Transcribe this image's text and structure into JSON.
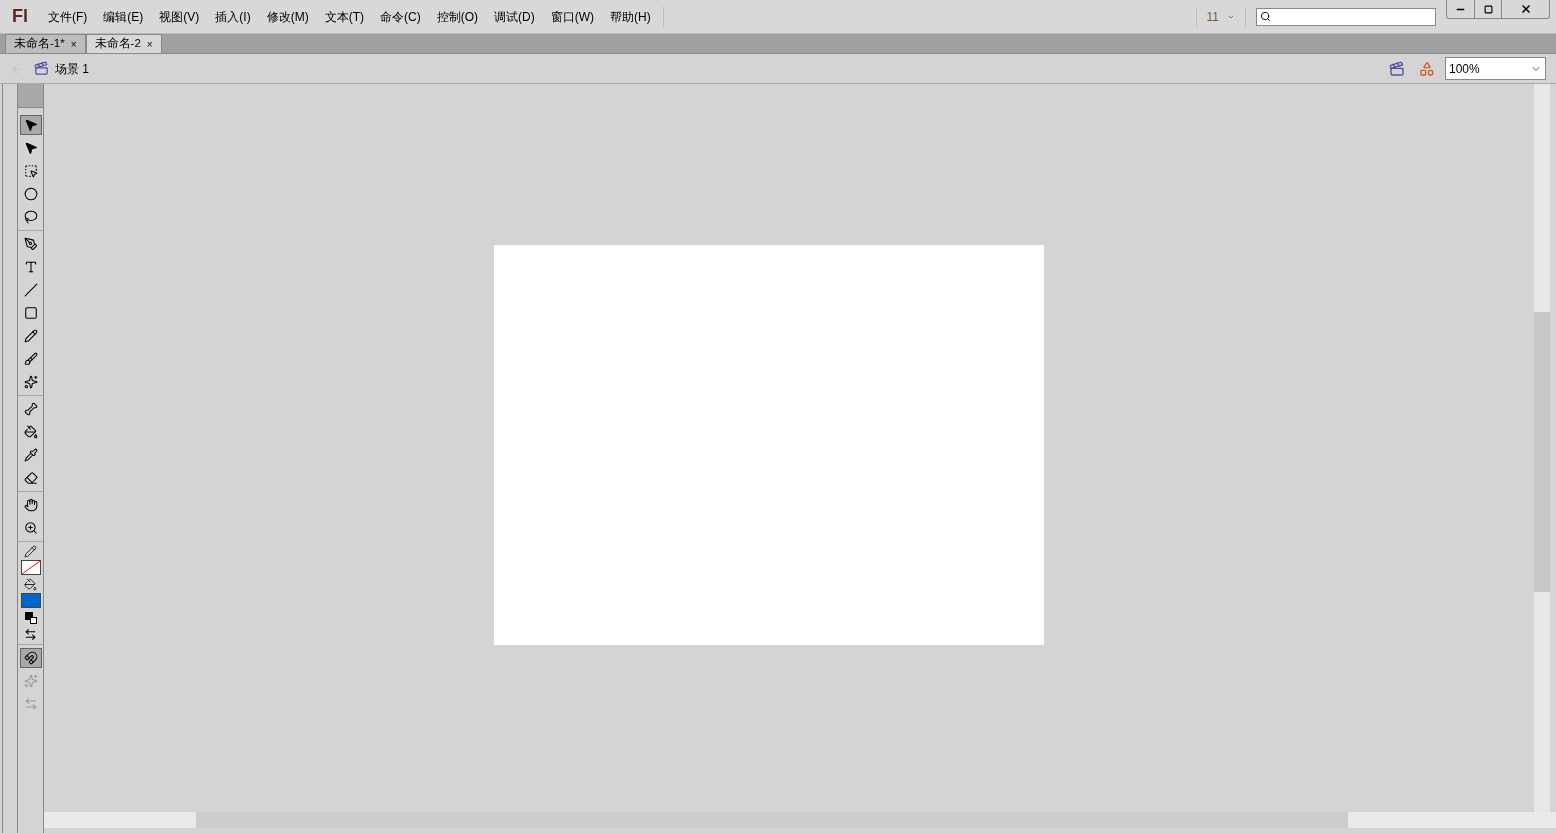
{
  "app": {
    "logo": "Fl"
  },
  "menu": [
    "文件(F)",
    "编辑(E)",
    "视图(V)",
    "插入(I)",
    "修改(M)",
    "文本(T)",
    "命令(C)",
    "控制(O)",
    "调试(D)",
    "窗口(W)",
    "帮助(H)"
  ],
  "workspace": {
    "label": "11"
  },
  "tabs": [
    {
      "label": "未命名-1*",
      "selected": false,
      "close": "×"
    },
    {
      "label": "未命名-2",
      "selected": true,
      "close": "×"
    }
  ],
  "edit_bar": {
    "scene": "场景 1",
    "zoom": "100%"
  },
  "tools": [
    [
      {
        "kind": "selection",
        "selected": true,
        "disabled": false
      },
      {
        "kind": "subselection",
        "selected": false,
        "disabled": false
      },
      {
        "kind": "transform",
        "selected": false,
        "disabled": false
      },
      {
        "kind": "sphere",
        "selected": false,
        "disabled": false
      },
      {
        "kind": "lasso",
        "selected": false,
        "disabled": false
      }
    ],
    [
      {
        "kind": "pen",
        "selected": false,
        "disabled": false
      },
      {
        "kind": "text",
        "selected": false,
        "disabled": false
      },
      {
        "kind": "line",
        "selected": false,
        "disabled": false
      },
      {
        "kind": "rect",
        "selected": false,
        "disabled": false
      },
      {
        "kind": "pencil",
        "selected": false,
        "disabled": false
      },
      {
        "kind": "brush",
        "selected": false,
        "disabled": false
      },
      {
        "kind": "deco",
        "selected": false,
        "disabled": false
      }
    ],
    [
      {
        "kind": "bone",
        "selected": false,
        "disabled": false
      },
      {
        "kind": "bucket",
        "selected": false,
        "disabled": false
      },
      {
        "kind": "eyedropper",
        "selected": false,
        "disabled": false
      },
      {
        "kind": "eraser",
        "selected": false,
        "disabled": false
      }
    ],
    [
      {
        "kind": "hand",
        "selected": false,
        "disabled": false
      },
      {
        "kind": "zoom",
        "selected": false,
        "disabled": false
      }
    ],
    [
      {
        "kind": "stroke",
        "no_color": true
      },
      {
        "kind": "fill",
        "color": "#0066cc"
      },
      {
        "kind": "default"
      },
      {
        "kind": "swap"
      }
    ],
    [
      {
        "kind": "magnet",
        "selected": true,
        "disabled": false
      },
      {
        "kind": "smooth",
        "selected": false,
        "disabled": true
      },
      {
        "kind": "straighten",
        "selected": false,
        "disabled": true
      }
    ]
  ]
}
